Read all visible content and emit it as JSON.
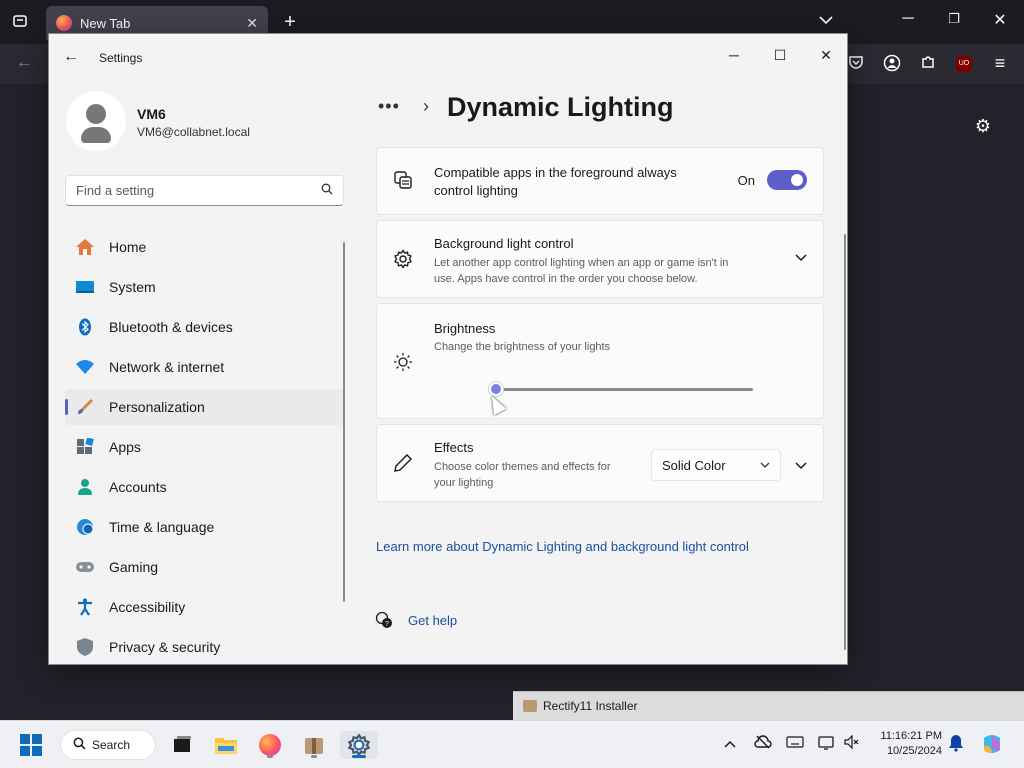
{
  "browser": {
    "tab_title": "New Tab",
    "tab_close": "✕",
    "new_tab": "+"
  },
  "window": {
    "title": "Settings"
  },
  "profile": {
    "name": "VM6",
    "email": "VM6@collabnet.local"
  },
  "search": {
    "placeholder": "Find a setting"
  },
  "nav": {
    "items": [
      {
        "label": "Home",
        "icon": "home-icon"
      },
      {
        "label": "System",
        "icon": "system-icon"
      },
      {
        "label": "Bluetooth & devices",
        "icon": "bluetooth-icon"
      },
      {
        "label": "Network & internet",
        "icon": "wifi-icon"
      },
      {
        "label": "Personalization",
        "icon": "brush-icon",
        "active": true
      },
      {
        "label": "Apps",
        "icon": "apps-icon"
      },
      {
        "label": "Accounts",
        "icon": "accounts-icon"
      },
      {
        "label": "Time & language",
        "icon": "globe-clock-icon"
      },
      {
        "label": "Gaming",
        "icon": "controller-icon"
      },
      {
        "label": "Accessibility",
        "icon": "accessibility-icon"
      },
      {
        "label": "Privacy & security",
        "icon": "shield-icon"
      }
    ]
  },
  "page": {
    "breadcrumb_more": "•••",
    "title": "Dynamic Lighting"
  },
  "settings": {
    "compatible": {
      "title_line1": "Compatible apps in the foreground always",
      "title_line2": "control lighting",
      "state": "On"
    },
    "background": {
      "title": "Background light control",
      "desc_line1": "Let another app control lighting when an app or game isn't in",
      "desc_line2": "use. Apps have control in the order you choose below."
    },
    "brightness": {
      "title": "Brightness",
      "desc": "Change the brightness of your lights",
      "value": 0
    },
    "effects": {
      "title": "Effects",
      "desc_line1": "Choose color themes and effects for",
      "desc_line2": "your lighting",
      "selected": "Solid Color"
    }
  },
  "links": {
    "learn_more": "Learn more about Dynamic Lighting and background light control",
    "get_help": "Get help"
  },
  "popup": {
    "label": "Rectify11 Installer"
  },
  "taskbar": {
    "search_label": "Search",
    "time": "11:16:21 PM",
    "date": "10/25/2024"
  },
  "colors": {
    "accent": "#5b5fc7",
    "link": "#1c4fa1"
  }
}
